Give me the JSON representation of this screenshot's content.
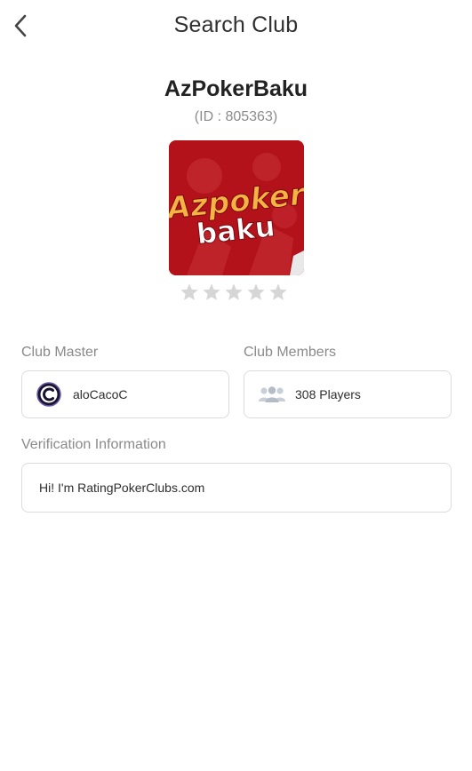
{
  "header": {
    "title": "Search Club",
    "back_icon": "chevron-left-icon"
  },
  "club": {
    "name": "AzPokerBaku",
    "id_text": "(ID : 805363)",
    "logo": {
      "line1": "Azpoker",
      "line2": "baku",
      "background_color": "#b4121a",
      "text_color_line1": "#f3b443",
      "text_color_line2": "#ffffff"
    },
    "rating": {
      "filled": 0,
      "max": 5
    }
  },
  "master": {
    "label": "Club Master",
    "name": "aloCacoC",
    "avatar_icon": "avatar-c-icon"
  },
  "members": {
    "label": "Club Members",
    "count_text": "308 Players",
    "icon": "people-group-icon"
  },
  "verification": {
    "label": "Verification Information",
    "message": "Hi! I'm RatingPokerClubs.com"
  },
  "colors": {
    "label_gray": "#8a8a8a",
    "border_gray": "#dcdcdc",
    "star_gray": "#d6d6d6"
  }
}
